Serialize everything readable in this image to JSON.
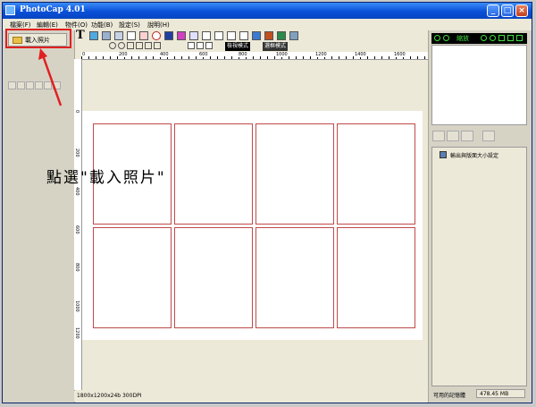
{
  "window": {
    "title": "PhotoCap 4.01",
    "controls": {
      "minimize": "_",
      "maximize": "□",
      "close": "×"
    }
  },
  "menubar": {
    "items": [
      "檔案(F)",
      "編輯(E)",
      "物件(O)",
      "功能(B)",
      "設定(S)",
      "說明(H)"
    ]
  },
  "left_panel": {
    "load_button_label": "載入照片"
  },
  "toolbar": {
    "text_tool": "T",
    "mode_left": "檢視模式",
    "mode_right": "選框模式"
  },
  "ruler": {
    "h_labels": [
      "0",
      "200",
      "400",
      "600",
      "800",
      "1000",
      "1200",
      "1400",
      "1600"
    ],
    "v_labels": [
      "0",
      "200",
      "400",
      "600",
      "800",
      "1000",
      "1200"
    ]
  },
  "canvas": {
    "rows": 2,
    "cols": 4,
    "annotation": "點選\"載入照片\""
  },
  "statusbar": {
    "info": "1800x1200x24b  300DPI"
  },
  "right_panel": {
    "zoom_label": "縮放",
    "output_item": "輸出與版面大小設定",
    "memory_label": "可用的記憶體",
    "memory_value": "478.45 MB"
  },
  "colors": {
    "title_blue": "#0a50d8",
    "highlight_red": "#e02020",
    "slot_border": "#c04a4a",
    "nav_green": "#3fe03f"
  }
}
